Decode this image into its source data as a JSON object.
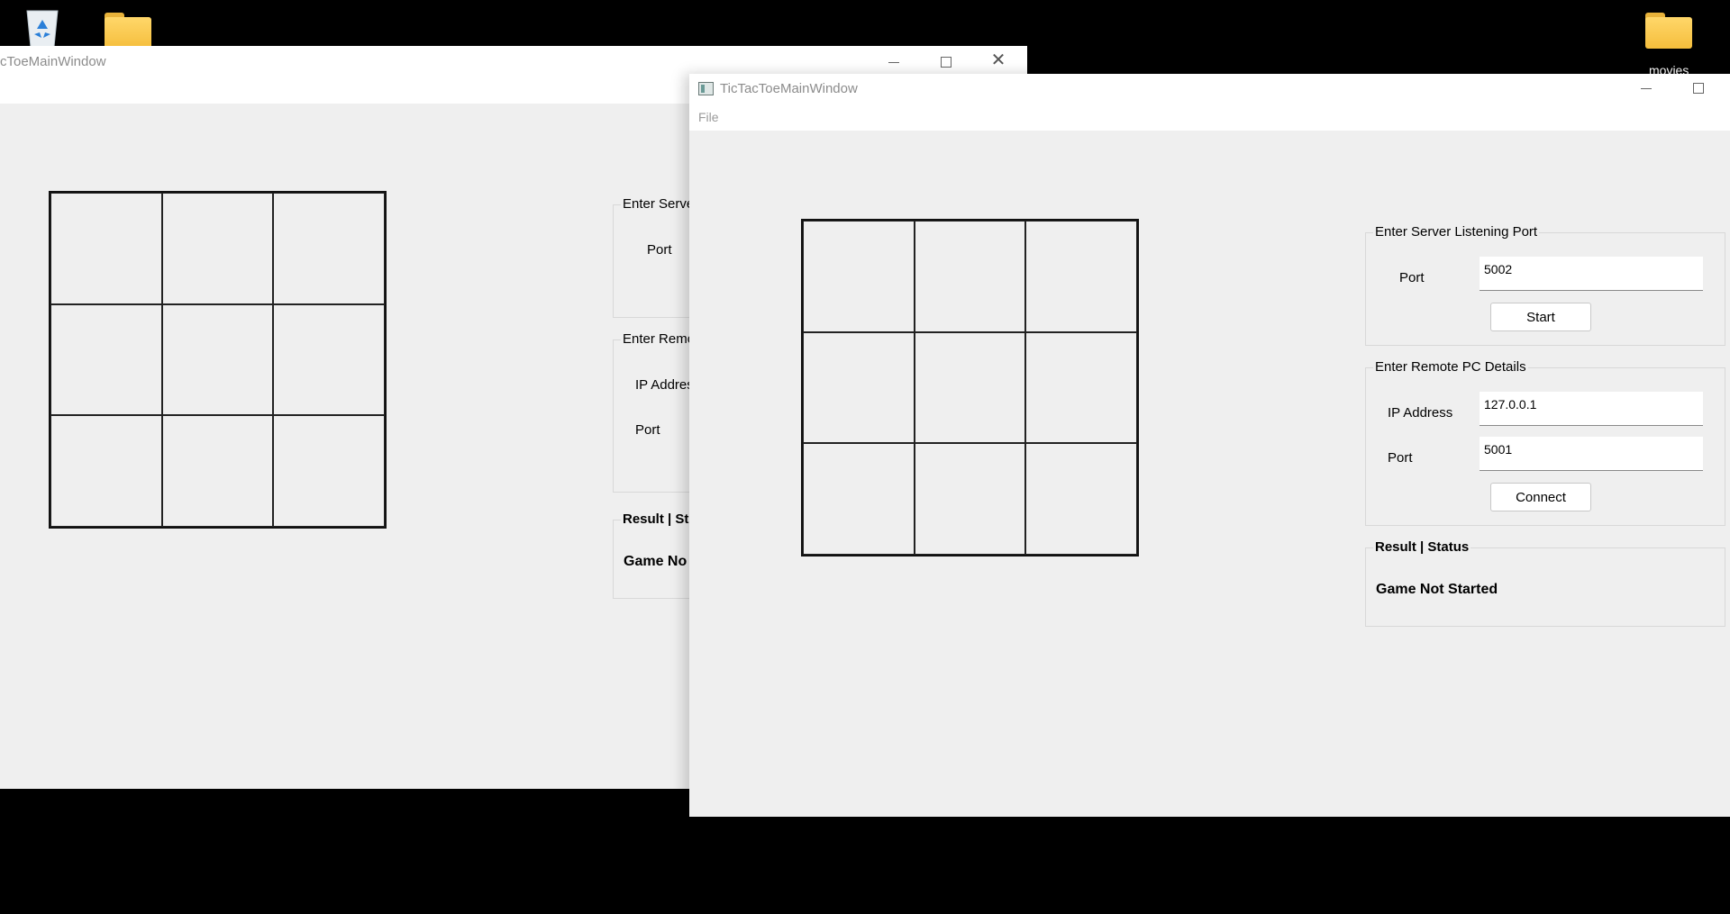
{
  "desktop": {
    "icons": [
      {
        "name": "recycle-bin-icon",
        "label": ""
      },
      {
        "name": "folder-icon",
        "label": ""
      },
      {
        "name": "folder-icon",
        "label": "movies"
      }
    ]
  },
  "back_window": {
    "title": "cToeMainWindow",
    "server_group": {
      "title": "Enter Serve",
      "port_label": "Port"
    },
    "remote_group": {
      "title": "Enter Remo",
      "ip_label": "IP Addres",
      "port_label": "Port"
    },
    "status_group": {
      "title": "Result | St",
      "status": "Game No"
    }
  },
  "front_window": {
    "title": "TicTacToeMainWindow",
    "menu": {
      "file": "File"
    },
    "server_group": {
      "title": "Enter Server Listening Port",
      "port_label": "Port",
      "port_value": "5002",
      "start_button": "Start"
    },
    "remote_group": {
      "title": "Enter Remote PC Details",
      "ip_label": "IP Address",
      "ip_value": "127.0.0.1",
      "port_label": "Port",
      "port_value": "5001",
      "connect_button": "Connect"
    },
    "status_group": {
      "title": "Result | Status",
      "status": "Game Not Started"
    }
  },
  "colors": {
    "desktop": "#000000",
    "window_bg": "#efefef",
    "titlebar": "#ffffff"
  }
}
